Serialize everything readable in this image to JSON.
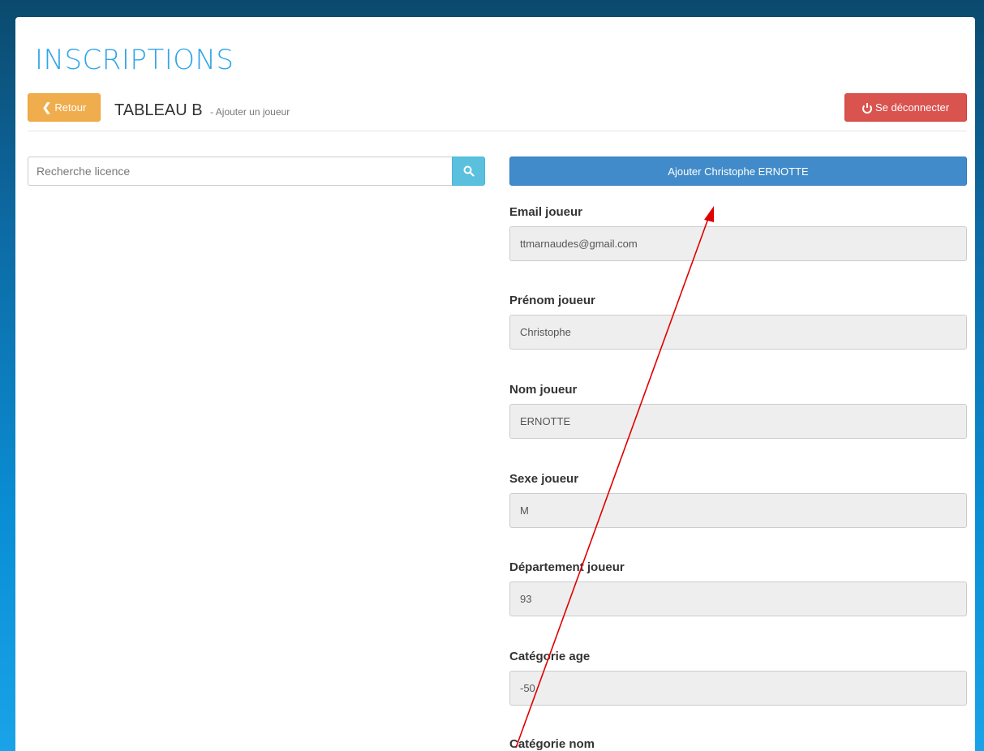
{
  "app": {
    "title": "INSCRIPTIONS"
  },
  "header": {
    "back_label": "Retour",
    "page_title": "TABLEAU B",
    "page_subtitle": "- Ajouter un joueur",
    "logout_label": "Se déconnecter"
  },
  "search": {
    "placeholder": "Recherche licence"
  },
  "form": {
    "add_button_label": "Ajouter Christophe ERNOTTE",
    "fields": [
      {
        "label": "Email joueur",
        "value": "ttmarnaudes@gmail.com"
      },
      {
        "label": "Prénom joueur",
        "value": "Christophe"
      },
      {
        "label": "Nom joueur",
        "value": "ERNOTTE"
      },
      {
        "label": "Sexe joueur",
        "value": "M"
      },
      {
        "label": "Département joueur",
        "value": "93"
      },
      {
        "label": "Catégorie age",
        "value": "-50"
      },
      {
        "label": "Catégorie nom",
        "value": ""
      }
    ]
  },
  "colors": {
    "title": "#2fa4e7",
    "back": "#f0ad4e",
    "logout": "#d9534f",
    "search_button": "#5bc0de",
    "add_button": "#428bca",
    "annotation_arrow": "#e00000"
  },
  "icons": {
    "back": "chevron-left-icon",
    "logout": "power-icon",
    "search": "search-icon"
  }
}
